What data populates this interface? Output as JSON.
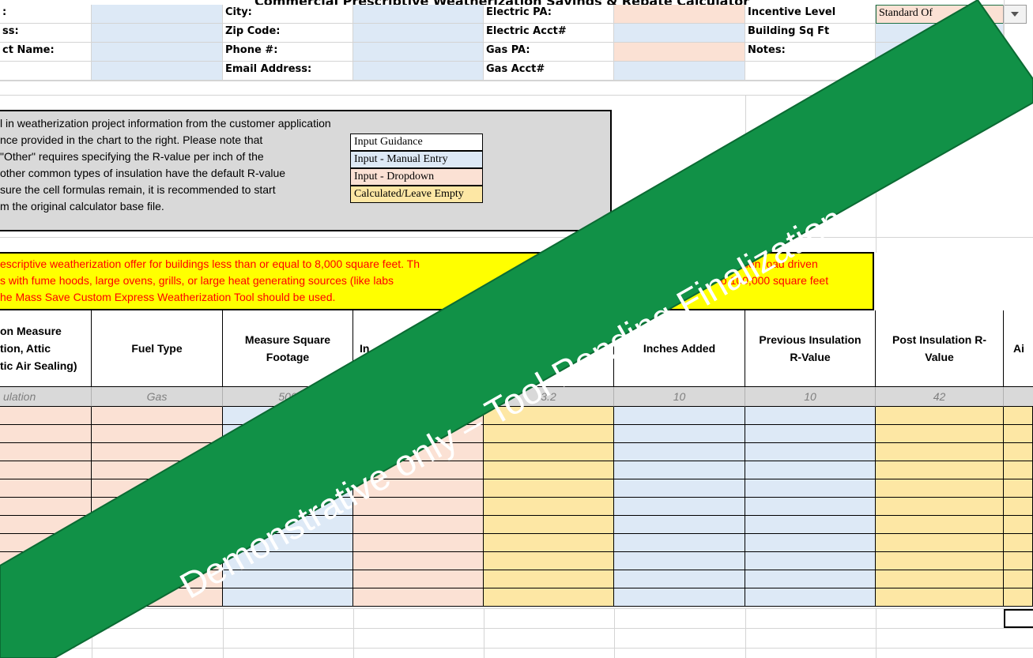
{
  "title": "Commercial Prescriptive Weatherization Savings & Rebate Calculator",
  "customer_info": {
    "col1": [
      ":",
      "ss:",
      "ct Name:",
      ""
    ],
    "col3": [
      "City:",
      "Zip Code:",
      "Phone #:",
      "Email Address:"
    ],
    "col5": [
      "Electric PA:",
      "Electric Acct#",
      "Gas PA:",
      "Gas Acct#"
    ],
    "col7": [
      "Incentive Level",
      "Building Sq Ft",
      "Notes:",
      ""
    ],
    "incentive_value": "Standard Of"
  },
  "guidance": {
    "lines": [
      "l in weatherization project information from the customer application",
      "nce provided in the chart to the right. Please note that",
      "\"Other\" requires specifying the R-value per inch of the",
      "other common types of insulation have the default R-value",
      "sure the cell formulas  remain, it is recommended to start",
      "m the original calculator base file."
    ],
    "legend": [
      "Input Guidance",
      "Input - Manual Entry",
      "Input - Dropdown",
      "Calculated/Leave Empty"
    ]
  },
  "warning": {
    "lines": [
      "escriptive weatherization offer for buildings less than or equal to 8,000 square feet. Th",
      "s with fume hoods, large ovens, grills, or large heat generating sources (like labs",
      "he Mass Save Custom Express Weatherization Tool should be used."
    ],
    "right_fragments": [
      "ation load driven",
      "to 100,000 square feet"
    ]
  },
  "table": {
    "headers": [
      "on Measure\ntion, Attic\ntic Air Sealing)",
      "Fuel Type",
      "Measure Square\nFootage",
      "In",
      "",
      "Inches Added",
      "Previous Insulation\nR-Value",
      "Post Insulation R-\nValue",
      "Ai"
    ],
    "example": [
      "ulation",
      "Gas",
      "500",
      "",
      "3.2",
      "10",
      "10",
      "42",
      ""
    ]
  },
  "banner_text": "Demonstrative only – Tool Pending Finalization",
  "colors": {
    "banner": "#119147",
    "blue": "#dde9f6",
    "peach": "#fbe1d4",
    "gold": "#fde7a4",
    "warn": "#ffff00"
  }
}
